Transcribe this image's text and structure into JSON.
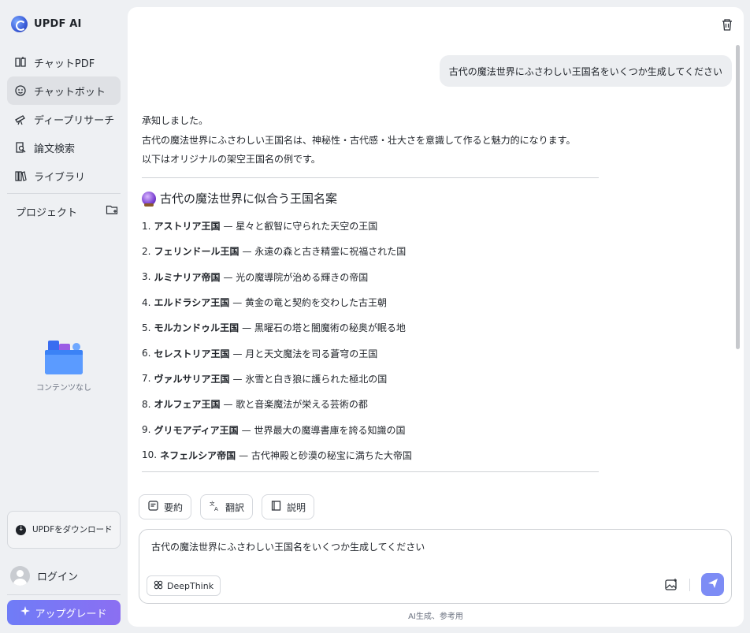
{
  "app": {
    "title": "UPDF AI"
  },
  "sidebar": {
    "items": [
      {
        "label": "チャットPDF",
        "icon": "book-icon"
      },
      {
        "label": "チャットボット",
        "icon": "chatbot-icon",
        "active": true
      },
      {
        "label": "ディープリサーチ",
        "icon": "telescope-icon"
      },
      {
        "label": "論文検索",
        "icon": "paper-search-icon"
      },
      {
        "label": "ライブラリ",
        "icon": "library-icon"
      }
    ],
    "project_label": "プロジェクト",
    "empty_label": "コンテンツなし",
    "download_label": "UPDFをダウンロード",
    "login_label": "ログイン",
    "upgrade_label": "アップグレード"
  },
  "chat": {
    "user_message": "古代の魔法世界にふさわしい王国名をいくつか生成してください",
    "intro": [
      "承知しました。",
      "古代の魔法世界にふさわしい王国名は、神秘性・古代感・壮大さを意識して作ると魅力的になります。",
      "以下はオリジナルの架空王国名の例です。"
    ],
    "heading": "古代の魔法世界に似合う王国名案",
    "kingdoms": [
      {
        "num": "1.",
        "name": "アストリア王国",
        "desc": "— 星々と叡智に守られた天空の王国"
      },
      {
        "num": "2.",
        "name": "フェリンドール王国",
        "desc": "— 永遠の森と古き精霊に祝福された国"
      },
      {
        "num": "3.",
        "name": "ルミナリア帝国",
        "desc": "— 光の魔導院が治める輝きの帝国"
      },
      {
        "num": "4.",
        "name": "エルドラシア王国",
        "desc": "— 黄金の竜と契約を交わした古王朝"
      },
      {
        "num": "5.",
        "name": "モルカンドゥル王国",
        "desc": "— 黒曜石の塔と闇魔術の秘奥が眠る地"
      },
      {
        "num": "6.",
        "name": "セレストリア王国",
        "desc": "— 月と天文魔法を司る蒼穹の王国"
      },
      {
        "num": "7.",
        "name": "ヴァルサリア王国",
        "desc": "— 氷雪と白き狼に護られた極北の国"
      },
      {
        "num": "8.",
        "name": "オルフェア王国",
        "desc": "— 歌と音楽魔法が栄える芸術の都"
      },
      {
        "num": "9.",
        "name": "グリモアディア王国",
        "desc": "— 世界最大の魔導書庫を誇る知識の国"
      },
      {
        "num": "10.",
        "name": "ネフェルシア帝国",
        "desc": "— 古代神殿と砂漠の秘宝に満ちた大帝国"
      }
    ],
    "actions": [
      {
        "label": "要約",
        "icon": "summary-icon"
      },
      {
        "label": "翻訳",
        "icon": "translate-icon"
      },
      {
        "label": "説明",
        "icon": "explain-icon"
      }
    ]
  },
  "composer": {
    "text": "古代の魔法世界にふさわしい王国名をいくつか生成してください",
    "deepthink_label": "DeepThink"
  },
  "footnote": "AI生成、参考用",
  "colors": {
    "accent": "#7d8cf5",
    "upgrade_gradient": [
      "#6f7cf7",
      "#8b6ff2"
    ],
    "sidebar_bg": "#eef0f3"
  }
}
